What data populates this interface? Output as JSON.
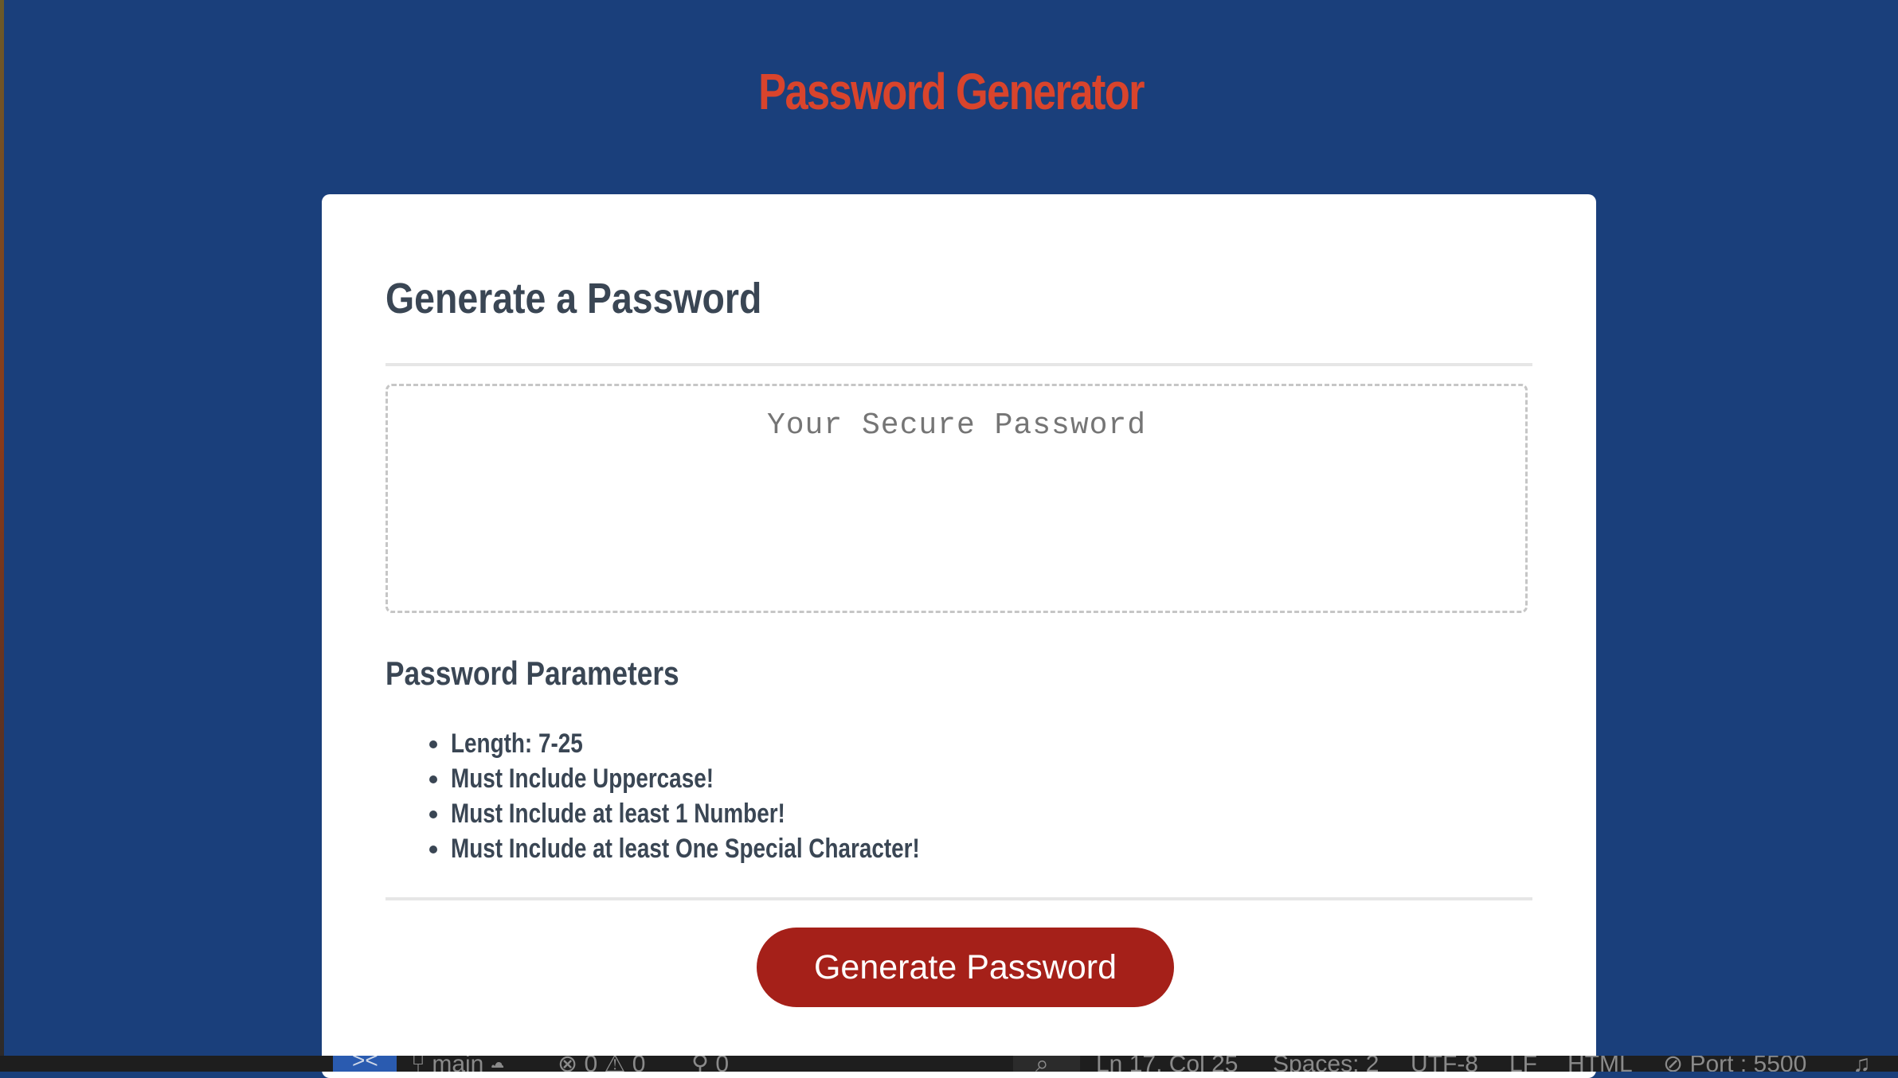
{
  "app": {
    "title": "Password Generator"
  },
  "card": {
    "header": "Generate a Password",
    "password_placeholder": "Your Secure Password",
    "password_value": "",
    "params_title": "Password Parameters",
    "params": [
      "Length: 7-25",
      "Must Include Uppercase!",
      "Must Include at least 1 Number!",
      "Must Include at least One Special Character!"
    ],
    "generate_button_label": "Generate Password"
  },
  "status_bar": {
    "remote_icon": "remote-chevron-icon",
    "branch_icon": "git-branch-icon",
    "branch": "main",
    "sync_icon": "cloud-sync-icon",
    "errors_icon": "error-circle-icon",
    "errors": "0",
    "warnings_icon": "warning-triangle-icon",
    "warnings": "0",
    "ports_icon": "broadcast-icon",
    "ports": "0",
    "zoom_icon": "zoom-icon",
    "cursor_position": "Ln 17, Col 25",
    "spaces": "Spaces: 2",
    "encoding": "UTF-8",
    "eol": "LF",
    "language": "HTML",
    "live_server_icon": "broadcast-circle-icon",
    "live_server": "Port : 5500",
    "notification_icon": "bell-icon"
  },
  "colors": {
    "page_background": "#1a3f7b",
    "title": "#d9442c",
    "card_background": "#ffffff",
    "text": "#3a4654",
    "button": "#a52019",
    "button_text": "#ffffff"
  }
}
